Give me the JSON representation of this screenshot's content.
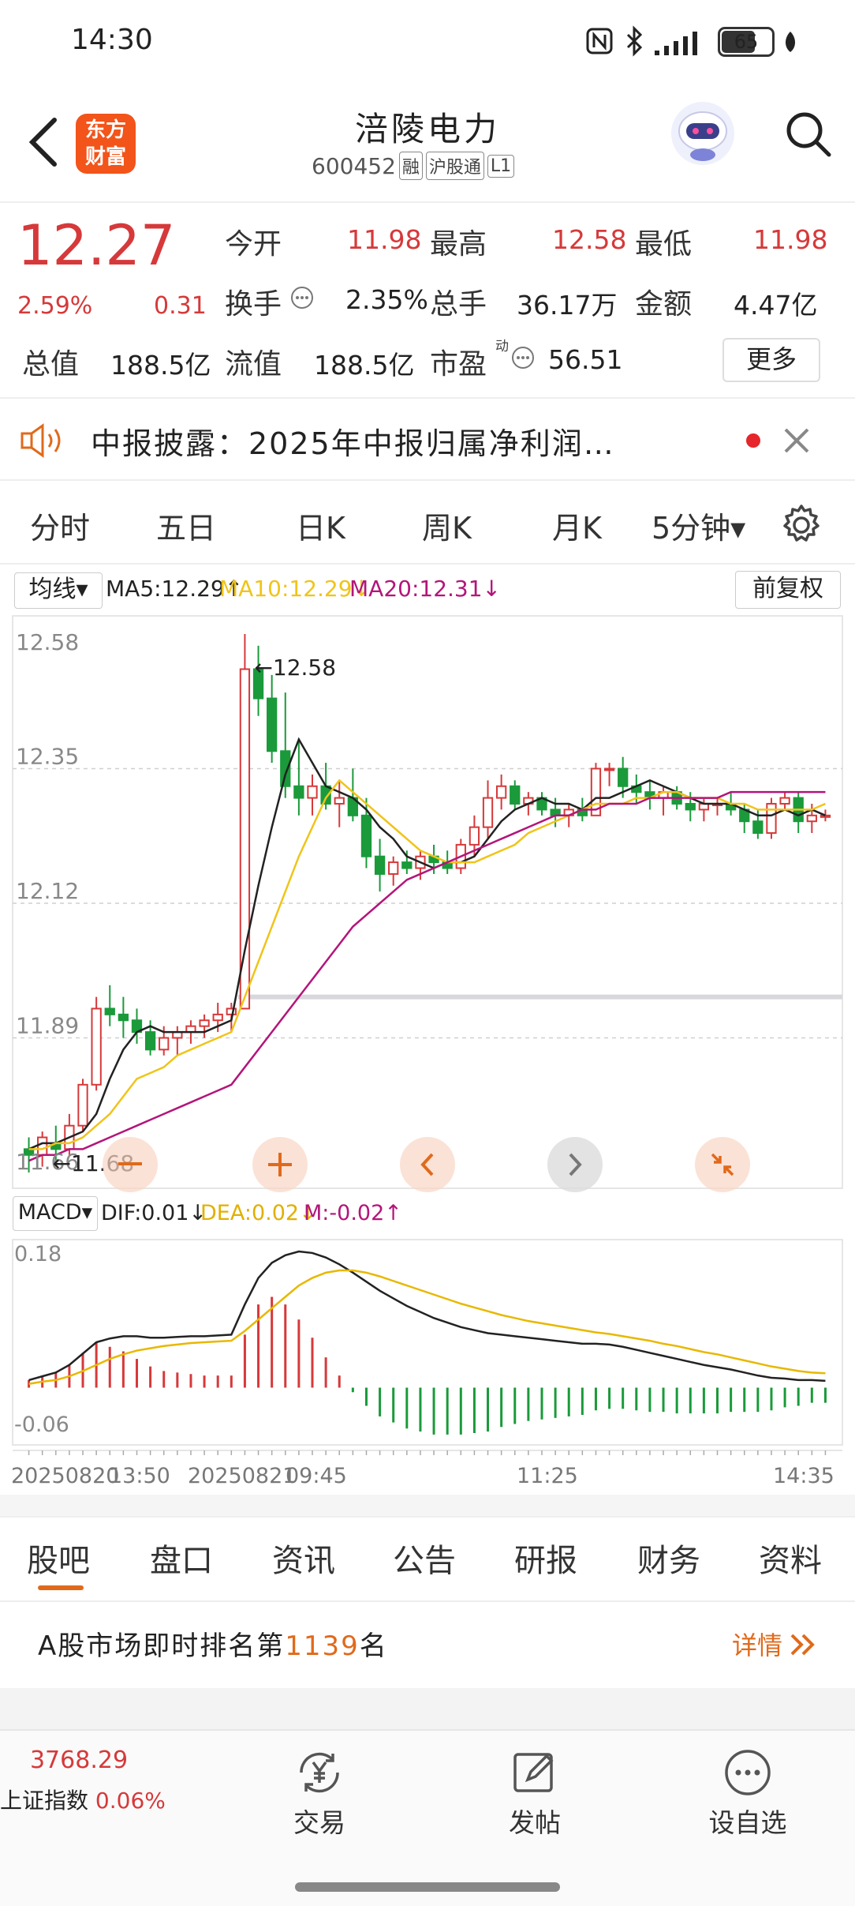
{
  "status": {
    "time": "14:30",
    "battery": "65"
  },
  "header": {
    "title": "涪陵电力",
    "code": "600452",
    "tags": [
      "融",
      "沪股通",
      "L1"
    ],
    "logo_text": "东方财富"
  },
  "quote": {
    "price": "12.27",
    "change_pct": "2.59%",
    "change": "0.31",
    "open_label": "今开",
    "open": "11.98",
    "high_label": "最高",
    "high": "12.58",
    "low_label": "最低",
    "low": "11.98",
    "turnover_label": "换手",
    "turnover": "2.35%",
    "volume_label": "总手",
    "volume": "36.17万",
    "amount_label": "金额",
    "amount": "4.47亿",
    "mktcap_label": "总值",
    "mktcap": "188.5亿",
    "float_label": "流值",
    "float": "188.5亿",
    "pe_label": "市盈",
    "pe_sup": "动",
    "pe": "56.51",
    "more_label": "更多"
  },
  "notice": {
    "text": "中报披露：2025年中报归属净利润…"
  },
  "periods": {
    "items": [
      "分时",
      "五日",
      "日K",
      "周K",
      "月K"
    ],
    "active": "5分钟▾"
  },
  "ma_legend": {
    "selector": "均线▾",
    "ma5": "MA5:12.29↑",
    "ma10": "MA10:12.29↓",
    "ma20": "MA20:12.31↓",
    "adjust": "前复权"
  },
  "macd_legend": {
    "selector": "MACD▾",
    "dif": "DIF:0.01↓",
    "dea": "DEA:0.02↓",
    "m": "M:-0.02↑"
  },
  "colors": {
    "up": "#d6393a",
    "down": "#1a9a3a",
    "ma5": "#222222",
    "ma10": "#f0c419",
    "ma20": "#b3157a",
    "accent": "#e06a1b"
  },
  "chart_data": [
    {
      "type": "candlestick",
      "title": "",
      "y_ticks": [
        "12.58",
        "12.35",
        "12.12",
        "11.89",
        "11.66"
      ],
      "ylim": [
        11.66,
        12.58
      ],
      "max_label": "←12.58",
      "min_label": "←11.68",
      "reference_line": 11.96,
      "candles": [
        {
          "o": 11.7,
          "h": 11.72,
          "l": 11.66,
          "c": 11.69
        },
        {
          "o": 11.69,
          "h": 11.73,
          "l": 11.67,
          "c": 11.72
        },
        {
          "o": 11.71,
          "h": 11.74,
          "l": 11.68,
          "c": 11.7
        },
        {
          "o": 11.7,
          "h": 11.76,
          "l": 11.69,
          "c": 11.74
        },
        {
          "o": 11.74,
          "h": 11.82,
          "l": 11.73,
          "c": 11.81
        },
        {
          "o": 11.81,
          "h": 11.96,
          "l": 11.8,
          "c": 11.94
        },
        {
          "o": 11.94,
          "h": 11.98,
          "l": 11.91,
          "c": 11.93
        },
        {
          "o": 11.93,
          "h": 11.96,
          "l": 11.89,
          "c": 11.92
        },
        {
          "o": 11.92,
          "h": 11.94,
          "l": 11.88,
          "c": 11.9
        },
        {
          "o": 11.9,
          "h": 11.92,
          "l": 11.86,
          "c": 11.87
        },
        {
          "o": 11.87,
          "h": 11.91,
          "l": 11.86,
          "c": 11.89
        },
        {
          "o": 11.89,
          "h": 11.91,
          "l": 11.86,
          "c": 11.9
        },
        {
          "o": 11.9,
          "h": 11.92,
          "l": 11.88,
          "c": 11.91
        },
        {
          "o": 11.91,
          "h": 11.93,
          "l": 11.89,
          "c": 11.92
        },
        {
          "o": 11.92,
          "h": 11.95,
          "l": 11.9,
          "c": 11.93
        },
        {
          "o": 11.93,
          "h": 11.95,
          "l": 11.9,
          "c": 11.94
        },
        {
          "o": 11.94,
          "h": 12.58,
          "l": 11.94,
          "c": 12.52
        },
        {
          "o": 12.52,
          "h": 12.56,
          "l": 12.44,
          "c": 12.47
        },
        {
          "o": 12.47,
          "h": 12.51,
          "l": 12.36,
          "c": 12.38
        },
        {
          "o": 12.38,
          "h": 12.48,
          "l": 12.3,
          "c": 12.32
        },
        {
          "o": 12.32,
          "h": 12.4,
          "l": 12.27,
          "c": 12.3
        },
        {
          "o": 12.3,
          "h": 12.34,
          "l": 12.27,
          "c": 12.32
        },
        {
          "o": 12.32,
          "h": 12.36,
          "l": 12.28,
          "c": 12.29
        },
        {
          "o": 12.29,
          "h": 12.33,
          "l": 12.25,
          "c": 12.3
        },
        {
          "o": 12.3,
          "h": 12.35,
          "l": 12.26,
          "c": 12.27
        },
        {
          "o": 12.27,
          "h": 12.3,
          "l": 12.18,
          "c": 12.2
        },
        {
          "o": 12.2,
          "h": 12.23,
          "l": 12.14,
          "c": 12.17
        },
        {
          "o": 12.17,
          "h": 12.2,
          "l": 12.15,
          "c": 12.19
        },
        {
          "o": 12.19,
          "h": 12.21,
          "l": 12.17,
          "c": 12.18
        },
        {
          "o": 12.18,
          "h": 12.21,
          "l": 12.16,
          "c": 12.2
        },
        {
          "o": 12.2,
          "h": 12.22,
          "l": 12.17,
          "c": 12.19
        },
        {
          "o": 12.19,
          "h": 12.21,
          "l": 12.17,
          "c": 12.18
        },
        {
          "o": 12.18,
          "h": 12.23,
          "l": 12.17,
          "c": 12.22
        },
        {
          "o": 12.22,
          "h": 12.27,
          "l": 12.2,
          "c": 12.25
        },
        {
          "o": 12.25,
          "h": 12.33,
          "l": 12.23,
          "c": 12.3
        },
        {
          "o": 12.3,
          "h": 12.34,
          "l": 12.28,
          "c": 12.32
        },
        {
          "o": 12.32,
          "h": 12.33,
          "l": 12.28,
          "c": 12.29
        },
        {
          "o": 12.29,
          "h": 12.31,
          "l": 12.27,
          "c": 12.3
        },
        {
          "o": 12.3,
          "h": 12.31,
          "l": 12.27,
          "c": 12.28
        },
        {
          "o": 12.28,
          "h": 12.3,
          "l": 12.25,
          "c": 12.27
        },
        {
          "o": 12.27,
          "h": 12.29,
          "l": 12.25,
          "c": 12.28
        },
        {
          "o": 12.28,
          "h": 12.3,
          "l": 12.26,
          "c": 12.27
        },
        {
          "o": 12.27,
          "h": 12.36,
          "l": 12.27,
          "c": 12.35
        },
        {
          "o": 12.35,
          "h": 12.36,
          "l": 12.32,
          "c": 12.35
        },
        {
          "o": 12.35,
          "h": 12.37,
          "l": 12.3,
          "c": 12.32
        },
        {
          "o": 12.32,
          "h": 12.34,
          "l": 12.29,
          "c": 12.31
        },
        {
          "o": 12.31,
          "h": 12.33,
          "l": 12.28,
          "c": 12.3
        },
        {
          "o": 12.3,
          "h": 12.32,
          "l": 12.27,
          "c": 12.31
        },
        {
          "o": 12.31,
          "h": 12.32,
          "l": 12.28,
          "c": 12.29
        },
        {
          "o": 12.29,
          "h": 12.31,
          "l": 12.26,
          "c": 12.28
        },
        {
          "o": 12.28,
          "h": 12.3,
          "l": 12.26,
          "c": 12.29
        },
        {
          "o": 12.29,
          "h": 12.3,
          "l": 12.27,
          "c": 12.29
        },
        {
          "o": 12.29,
          "h": 12.31,
          "l": 12.27,
          "c": 12.28
        },
        {
          "o": 12.28,
          "h": 12.29,
          "l": 12.24,
          "c": 12.26
        },
        {
          "o": 12.26,
          "h": 12.28,
          "l": 12.23,
          "c": 12.24
        },
        {
          "o": 12.24,
          "h": 12.3,
          "l": 12.23,
          "c": 12.29
        },
        {
          "o": 12.29,
          "h": 12.31,
          "l": 12.28,
          "c": 12.3
        },
        {
          "o": 12.3,
          "h": 12.31,
          "l": 12.24,
          "c": 12.26
        },
        {
          "o": 12.26,
          "h": 12.29,
          "l": 12.24,
          "c": 12.27
        },
        {
          "o": 12.27,
          "h": 12.28,
          "l": 12.26,
          "c": 12.27
        }
      ],
      "ma5": [
        11.7,
        11.71,
        11.71,
        11.72,
        11.73,
        11.76,
        11.82,
        11.87,
        11.9,
        11.91,
        11.9,
        11.9,
        11.9,
        11.9,
        11.91,
        11.92,
        12.04,
        12.15,
        12.25,
        12.34,
        12.4,
        12.36,
        12.32,
        12.31,
        12.3,
        12.28,
        12.25,
        12.23,
        12.2,
        12.19,
        12.18,
        12.19,
        12.19,
        12.2,
        12.23,
        12.26,
        12.28,
        12.29,
        12.3,
        12.29,
        12.29,
        12.28,
        12.3,
        12.3,
        12.31,
        12.32,
        12.33,
        12.32,
        12.31,
        12.3,
        12.29,
        12.29,
        12.29,
        12.28,
        12.27,
        12.27,
        12.28,
        12.27,
        12.28,
        12.27
      ],
      "ma10": [
        11.7,
        11.7,
        11.71,
        11.71,
        11.72,
        11.74,
        11.76,
        11.79,
        11.82,
        11.83,
        11.84,
        11.86,
        11.87,
        11.88,
        11.89,
        11.9,
        11.96,
        12.02,
        12.08,
        12.14,
        12.2,
        12.25,
        12.3,
        12.33,
        12.31,
        12.29,
        12.27,
        12.25,
        12.23,
        12.21,
        12.2,
        12.19,
        12.19,
        12.19,
        12.2,
        12.21,
        12.22,
        12.24,
        12.25,
        12.26,
        12.27,
        12.28,
        12.29,
        12.29,
        12.29,
        12.3,
        12.3,
        12.31,
        12.31,
        12.3,
        12.3,
        12.3,
        12.29,
        12.29,
        12.28,
        12.28,
        12.28,
        12.28,
        12.28,
        12.29
      ],
      "ma20": [
        11.68,
        11.69,
        11.69,
        11.7,
        11.7,
        11.71,
        11.72,
        11.73,
        11.74,
        11.75,
        11.76,
        11.77,
        11.78,
        11.79,
        11.8,
        11.81,
        11.84,
        11.87,
        11.9,
        11.93,
        11.96,
        11.99,
        12.02,
        12.05,
        12.08,
        12.1,
        12.12,
        12.14,
        12.16,
        12.17,
        12.18,
        12.19,
        12.2,
        12.21,
        12.22,
        12.23,
        12.24,
        12.25,
        12.26,
        12.27,
        12.27,
        12.28,
        12.28,
        12.29,
        12.29,
        12.29,
        12.3,
        12.3,
        12.3,
        12.3,
        12.3,
        12.3,
        12.31,
        12.31,
        12.31,
        12.31,
        12.31,
        12.31,
        12.31,
        12.31
      ],
      "x_labels": [
        "20250820",
        "13:50",
        "20250821",
        "09:45",
        "11:25",
        "14:35"
      ]
    },
    {
      "type": "macd",
      "y_ticks": [
        "0.18",
        "-0.06"
      ],
      "ylim": [
        -0.06,
        0.18
      ],
      "dif": [
        0.01,
        0.015,
        0.02,
        0.03,
        0.045,
        0.06,
        0.065,
        0.068,
        0.068,
        0.066,
        0.066,
        0.067,
        0.068,
        0.068,
        0.069,
        0.07,
        0.11,
        0.145,
        0.165,
        0.175,
        0.18,
        0.178,
        0.172,
        0.163,
        0.152,
        0.14,
        0.128,
        0.118,
        0.108,
        0.1,
        0.092,
        0.086,
        0.08,
        0.076,
        0.072,
        0.07,
        0.068,
        0.066,
        0.064,
        0.062,
        0.06,
        0.058,
        0.058,
        0.057,
        0.054,
        0.05,
        0.046,
        0.042,
        0.038,
        0.034,
        0.03,
        0.027,
        0.024,
        0.02,
        0.016,
        0.013,
        0.012,
        0.01,
        0.01,
        0.009
      ],
      "dea": [
        0.005,
        0.008,
        0.01,
        0.015,
        0.022,
        0.03,
        0.038,
        0.044,
        0.049,
        0.052,
        0.055,
        0.057,
        0.059,
        0.06,
        0.061,
        0.062,
        0.075,
        0.09,
        0.105,
        0.12,
        0.135,
        0.145,
        0.152,
        0.155,
        0.155,
        0.152,
        0.147,
        0.141,
        0.135,
        0.129,
        0.123,
        0.117,
        0.111,
        0.106,
        0.101,
        0.096,
        0.092,
        0.088,
        0.085,
        0.082,
        0.079,
        0.076,
        0.073,
        0.071,
        0.068,
        0.065,
        0.062,
        0.058,
        0.055,
        0.051,
        0.047,
        0.044,
        0.04,
        0.036,
        0.032,
        0.028,
        0.025,
        0.022,
        0.02,
        0.019
      ],
      "hist": [
        0.01,
        0.014,
        0.02,
        0.03,
        0.046,
        0.06,
        0.054,
        0.048,
        0.038,
        0.028,
        0.022,
        0.02,
        0.018,
        0.016,
        0.016,
        0.016,
        0.07,
        0.11,
        0.12,
        0.11,
        0.09,
        0.066,
        0.04,
        0.016,
        -0.006,
        -0.024,
        -0.038,
        -0.046,
        -0.054,
        -0.058,
        -0.062,
        -0.062,
        -0.062,
        -0.06,
        -0.058,
        -0.052,
        -0.048,
        -0.044,
        -0.042,
        -0.04,
        -0.038,
        -0.036,
        -0.03,
        -0.028,
        -0.028,
        -0.03,
        -0.032,
        -0.032,
        -0.034,
        -0.034,
        -0.034,
        -0.034,
        -0.032,
        -0.032,
        -0.032,
        -0.03,
        -0.026,
        -0.024,
        -0.02,
        -0.02
      ]
    }
  ],
  "bottom_tabs": {
    "items": [
      "股吧",
      "盘口",
      "资讯",
      "公告",
      "研报",
      "财务",
      "资料"
    ],
    "active_index": 0
  },
  "rank": {
    "prefix": "A股市场即时排名第",
    "number": "1139",
    "suffix": "名",
    "detail": "详情"
  },
  "navbar": {
    "index_value": "3768.29",
    "index_name": "上证指数",
    "index_change": "0.06%",
    "trade": "交易",
    "post": "发帖",
    "watchlist": "设自选"
  }
}
